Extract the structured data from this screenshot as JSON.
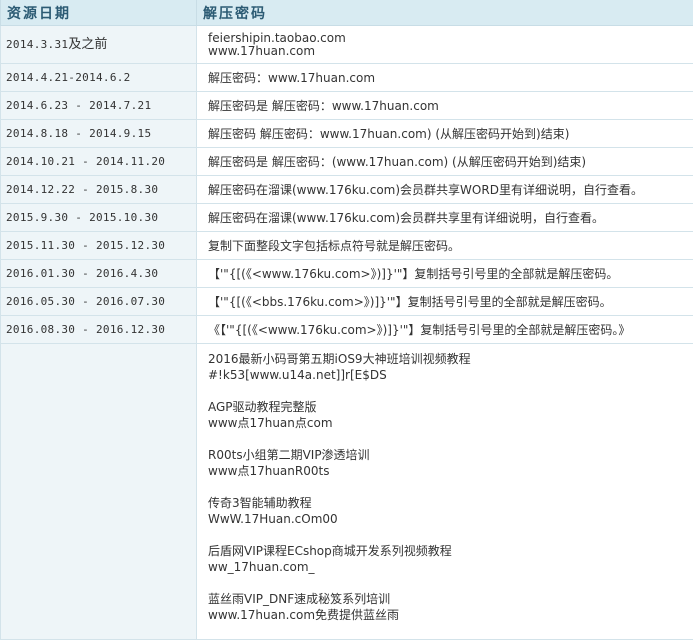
{
  "header": {
    "col1": "资源日期",
    "col2": "解压密码"
  },
  "rows": [
    {
      "date": "2014.3.31",
      "date_suffix": "及之前",
      "lines": [
        "feiershipin.taobao.com",
        "www.17huan.com"
      ]
    },
    {
      "date": "2014.4.21-2014.6.2",
      "lines": [
        "解压密码：www.17huan.com"
      ]
    },
    {
      "date": "2014.6.23 - 2014.7.21",
      "lines": [
        "解压密码是 解压密码：www.17huan.com"
      ]
    },
    {
      "date": "2014.8.18 - 2014.9.15",
      "lines": [
        "解压密码 解压密码：www.17huan.com) (从解压密码开始到)结束)"
      ]
    },
    {
      "date": "2014.10.21 - 2014.11.20",
      "lines": [
        "解压密码是 解压密码：(www.17huan.com) (从解压密码开始到)结束)"
      ]
    },
    {
      "date": "2014.12.22 - 2015.8.30",
      "lines": [
        "解压密码在溜课(www.176ku.com)会员群共享WORD里有详细说明，自行查看。"
      ]
    },
    {
      "date": "2015.9.30 - 2015.10.30",
      "lines": [
        "解压密码在溜课(www.176ku.com)会员群共享里有详细说明，自行查看。"
      ]
    },
    {
      "date": "2015.11.30 - 2015.12.30",
      "lines": [
        "复制下面整段文字包括标点符号就是解压密码。"
      ]
    },
    {
      "date": "2016.01.30 - 2016.4.30",
      "lines": [
        "【'\"{[(《<www.176ku.com>》)]}'\"】复制括号引号里的全部就是解压密码。"
      ]
    },
    {
      "date": "2016.05.30 - 2016.07.30",
      "lines": [
        "【'\"{[(《<bbs.176ku.com>》)]}'\"】复制括号引号里的全部就是解压密码。"
      ]
    },
    {
      "date": "2016.08.30 - 2016.12.30",
      "lines": [
        "《【'\"{[(《<www.176ku.com>》)]}'\"】复制括号引号里的全部就是解压密码。》"
      ]
    }
  ],
  "courses": [
    {
      "title": "2016最新小码哥第五期iOS9大神班培训视频教程",
      "code": "#!k53[www.u14a.net]]r[E$DS"
    },
    {
      "title": "AGP驱动教程完整版",
      "code": "www点17huan点com"
    },
    {
      "title": "R00ts小组第二期VIP渗透培训",
      "code": "www点17huanR00ts"
    },
    {
      "title": "传奇3智能辅助教程",
      "code": "WwW.17Huan.cOm00"
    },
    {
      "title": "后盾网VIP课程ECshop商城开发系列视频教程",
      "code": "ww_17huan.com_"
    },
    {
      "title": "蓝丝雨VIP_DNF速成秘笈系列培训",
      "code": "www.17huan.com免费提供蓝丝雨"
    }
  ]
}
